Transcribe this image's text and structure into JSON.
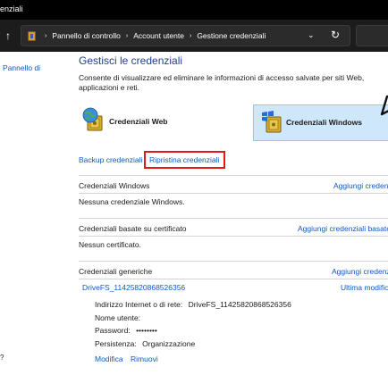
{
  "window": {
    "title": "enziali"
  },
  "address_bar": {
    "crumbs": [
      "Pannello di controllo",
      "Account utente",
      "Gestione credenziali"
    ]
  },
  "icons": {
    "back": "up-arrow-icon",
    "folder": "control-panel-icon",
    "dropdown": "chevron-down-icon",
    "refresh": "refresh-icon",
    "web_credentials": "globe-vault-icon",
    "windows_credentials": "windows-vault-icon"
  },
  "sidebar": {
    "link": "Pannello di",
    "help": "?"
  },
  "main": {
    "title": "Gestisci le credenziali",
    "description": "Consente di visualizzare ed eliminare le informazioni di accesso salvate per siti Web, applicazioni e reti.",
    "cred_types": {
      "web": "Credenziali Web",
      "windows": "Credenziali Windows",
      "selected": "windows"
    },
    "links": {
      "backup": "Backup credenziali",
      "restore": "Ripristina credenziali"
    },
    "sections": [
      {
        "label": "Credenziali Windows",
        "action": "Aggiungi credenzi",
        "empty": "Nessuna credenziale Windows."
      },
      {
        "label": "Credenziali basate su certificato",
        "action": "Aggiungi credenziali basate",
        "empty": "Nessun certificato."
      },
      {
        "label": "Credenziali generiche",
        "action": "Aggiungi credenzi"
      }
    ],
    "entry": {
      "name": "DriveFS_114258208685263​56",
      "modified_label": "Ultima modific",
      "details": {
        "address_label": "Indirizzo Internet o di rete:",
        "address_value": "DriveFS_11425820868526356",
        "user_label": "Nome utente:",
        "user_value": "",
        "password_label": "Password:",
        "password_value": "••••••••",
        "persistence_label": "Persistenza:",
        "persistence_value": "Organizzazione"
      },
      "actions": {
        "edit": "Modifica",
        "remove": "Rimuovi"
      }
    }
  },
  "colors": {
    "link": "#0b59c7",
    "title": "#1e3f8f",
    "selected_bg": "#cfe7fb",
    "highlight_border": "#e01919",
    "titlebar": "#000000"
  }
}
